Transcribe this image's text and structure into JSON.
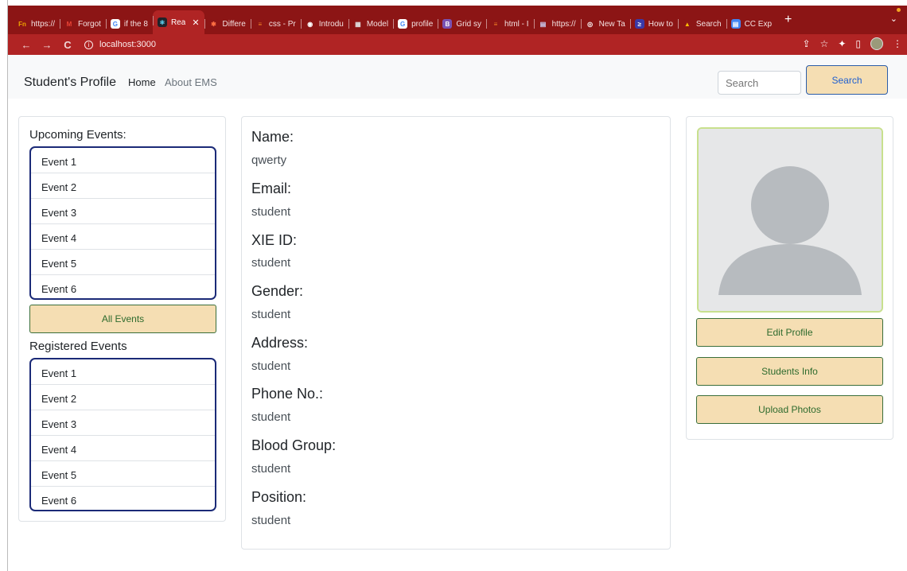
{
  "browser": {
    "tabs": [
      {
        "label": "https://",
        "fav": "Fn",
        "color": "#8c1515",
        "favtext": "#f0a500"
      },
      {
        "label": "Forgot",
        "fav": "M",
        "color": "#8c1515",
        "favtext": "#ea4335"
      },
      {
        "label": "if the 8",
        "fav": "G",
        "color": "#ffffff",
        "favtext": "#4285f4"
      },
      {
        "label": "Rea",
        "fav": "⚛",
        "color": "#20232a",
        "favtext": "#61dafb",
        "active": true
      },
      {
        "label": "Differe",
        "fav": "✱",
        "color": "#8c1515",
        "favtext": "#ff7043"
      },
      {
        "label": "css - Pr",
        "fav": "≡",
        "color": "#8c1515",
        "favtext": "#f48024"
      },
      {
        "label": "Introdu",
        "fav": "◉",
        "color": "#8c1515",
        "favtext": "#ffffff"
      },
      {
        "label": "Model",
        "fav": "▦",
        "color": "#8c1515",
        "favtext": "#e0e0e0"
      },
      {
        "label": "profile",
        "fav": "G",
        "color": "#ffffff",
        "favtext": "#4285f4"
      },
      {
        "label": "Grid sy",
        "fav": "B",
        "color": "#7952b3",
        "favtext": "#ffffff"
      },
      {
        "label": "html - I",
        "fav": "≡",
        "color": "#8c1515",
        "favtext": "#f48024"
      },
      {
        "label": "https://",
        "fav": "▤",
        "color": "#8c1515",
        "favtext": "#cfd8ff"
      },
      {
        "label": "New Ta",
        "fav": "◎",
        "color": "#8c1515",
        "favtext": "#ffffff"
      },
      {
        "label": "How to",
        "fav": "≥",
        "color": "#3a3aa8",
        "favtext": "#ffffff"
      },
      {
        "label": "Search",
        "fav": "▲",
        "color": "#8c1515",
        "favtext": "#fbbc05"
      },
      {
        "label": "CC Exp",
        "fav": "▤",
        "color": "#4285f4",
        "favtext": "#ffffff"
      }
    ],
    "close_glyph": "✕",
    "new_tab_glyph": "+",
    "tab_menu_glyph": "⌄",
    "back_glyph": "←",
    "forward_glyph": "→",
    "reload_glyph": "C",
    "info_glyph": "i",
    "url": "localhost:3000",
    "toolbar_icons": {
      "share": "⇪",
      "star": "☆",
      "extensions": "✦",
      "sidebar": "▯",
      "menu": "⋮"
    }
  },
  "navbar": {
    "brand": "Student's Profile",
    "links": [
      "Home",
      "About EMS"
    ],
    "search_placeholder": "Search",
    "search_button": "Search"
  },
  "left_panel": {
    "upcoming_title": "Upcoming Events:",
    "upcoming_events": [
      "Event 1",
      "Event 2",
      "Event 3",
      "Event 4",
      "Event 5",
      "Event 6"
    ],
    "all_events_button": "All Events",
    "registered_title": "Registered Events",
    "registered_events": [
      "Event 1",
      "Event 2",
      "Event 3",
      "Event 4",
      "Event 5",
      "Event 6"
    ]
  },
  "profile": {
    "fields": [
      {
        "label": "Name:",
        "value": "qwerty"
      },
      {
        "label": "Email:",
        "value": "student"
      },
      {
        "label": "XIE ID:",
        "value": "student"
      },
      {
        "label": "Gender:",
        "value": "student"
      },
      {
        "label": "Address:",
        "value": "student"
      },
      {
        "label": "Phone No.:",
        "value": "student"
      },
      {
        "label": "Blood Group:",
        "value": "student"
      },
      {
        "label": "Position:",
        "value": "student"
      }
    ]
  },
  "right_panel": {
    "avatar_icon": "person-placeholder-icon",
    "buttons": [
      "Edit Profile",
      "Students Info",
      "Upload Photos"
    ]
  },
  "colors": {
    "browser_frame": "#8c1515",
    "toolbar": "#b02424",
    "button_bg": "#f5deb3",
    "button_text": "#2e6b2e",
    "list_border": "#1b2a77",
    "photo_border": "#c8e08e"
  }
}
